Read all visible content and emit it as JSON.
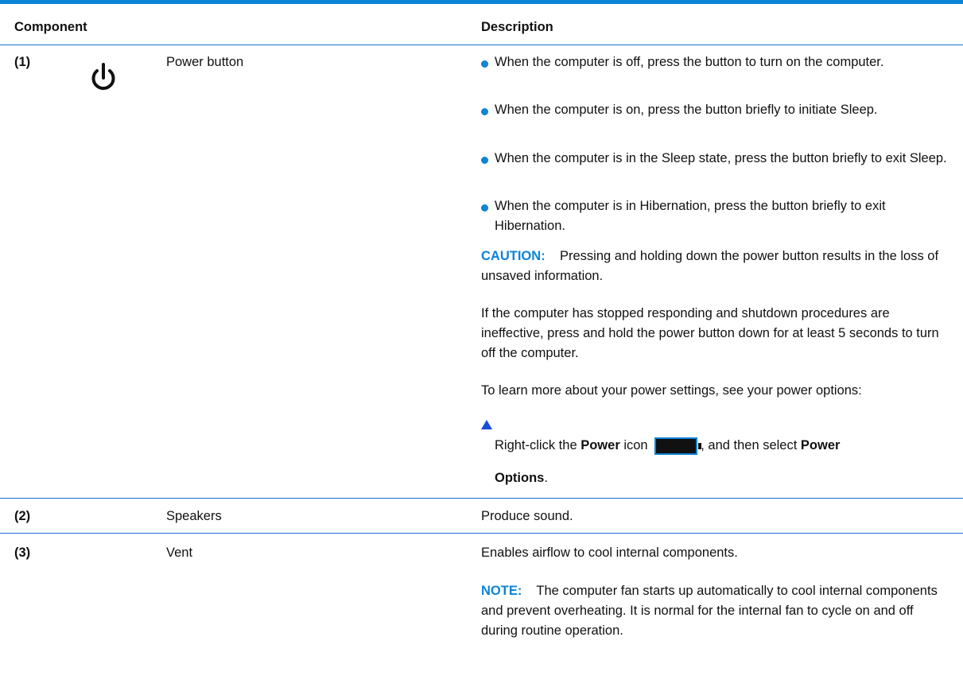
{
  "header": {
    "component": "Component",
    "description": "Description"
  },
  "rows": [
    {
      "number": "(1)",
      "icon": "power-icon",
      "name": "Power button",
      "bullets": [
        "When the computer is off, press the button to turn on the computer.",
        "When the computer is on, press the button briefly to initiate Sleep.",
        "When the computer is in the Sleep state, press the button briefly to exit Sleep.",
        "When the computer is in Hibernation, press the button briefly to exit Hibernation."
      ],
      "caution_label": "CAUTION:",
      "caution_text": "Pressing and holding down the power button results in the loss of unsaved information.",
      "paragraph1": "If the computer has stopped responding and shutdown procedures are ineffective, press and hold the power button down for at least 5 seconds to turn off the computer.",
      "paragraph2": "To learn more about your power settings, see your power options:",
      "step": {
        "prefix": "Right-click the",
        "bold1": "Power",
        "mid": "icon",
        "after_icon": ", and then select",
        "bold2": "Power",
        "bold3": "Options",
        "end": ".",
        "icon": "battery-icon"
      }
    },
    {
      "number": "(2)",
      "name": "Speakers",
      "description": "Produce sound."
    },
    {
      "number": "(3)",
      "name": "Vent",
      "description": "Enables airflow to cool internal components.",
      "note_label": "NOTE:",
      "note_text": "The computer fan starts up automatically to cool internal components and prevent overheating. It is normal for the internal fan to cycle on and off during routine operation."
    }
  ],
  "colors": {
    "accent": "#0a84d8",
    "rule": "#1a6fd0",
    "triangle": "#1a4ed8"
  }
}
